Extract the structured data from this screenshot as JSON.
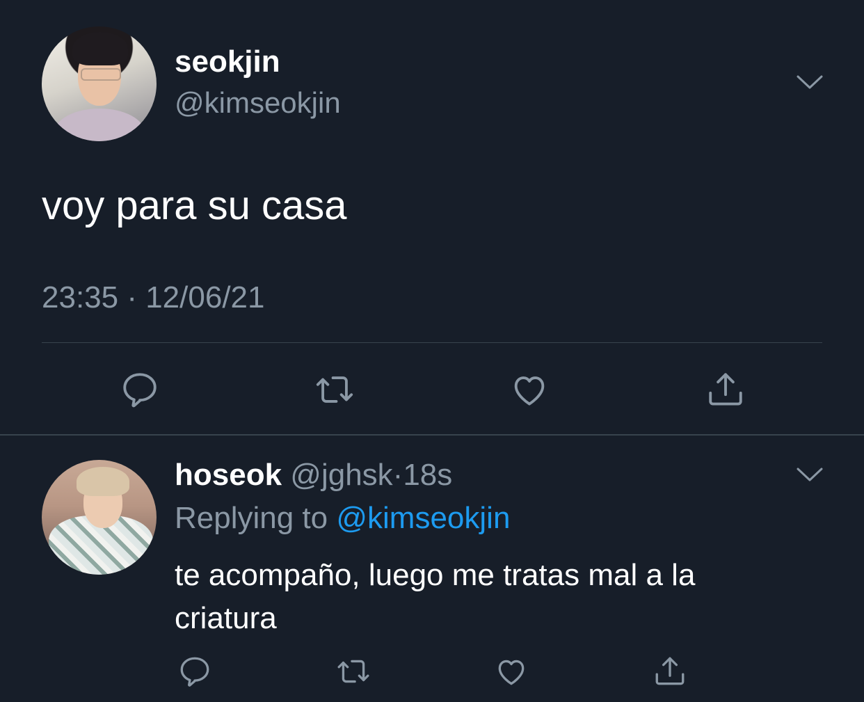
{
  "main_tweet": {
    "display_name": "seokjin",
    "handle": "@kimseokjin",
    "text": "voy para su casa",
    "timestamp": "23:35 · 12/06/21",
    "avatar_icon": "avatar-photo"
  },
  "reply_tweet": {
    "display_name": "hoseok",
    "handle": "@jghsk",
    "separator": "·",
    "time_ago": "18s",
    "replying_prefix": "Replying to ",
    "replying_mention": "@kimseokjin",
    "text": "te acompaño, luego me tratas mal a la criatura",
    "avatar_icon": "avatar-photo"
  },
  "actions": [
    "reply-icon",
    "retweet-icon",
    "like-icon",
    "share-icon"
  ],
  "colors": {
    "background": "#171e29",
    "primary_text": "#ffffff",
    "secondary_text": "#8b98a5",
    "accent": "#1d9bf0",
    "divider": "#38444d"
  }
}
